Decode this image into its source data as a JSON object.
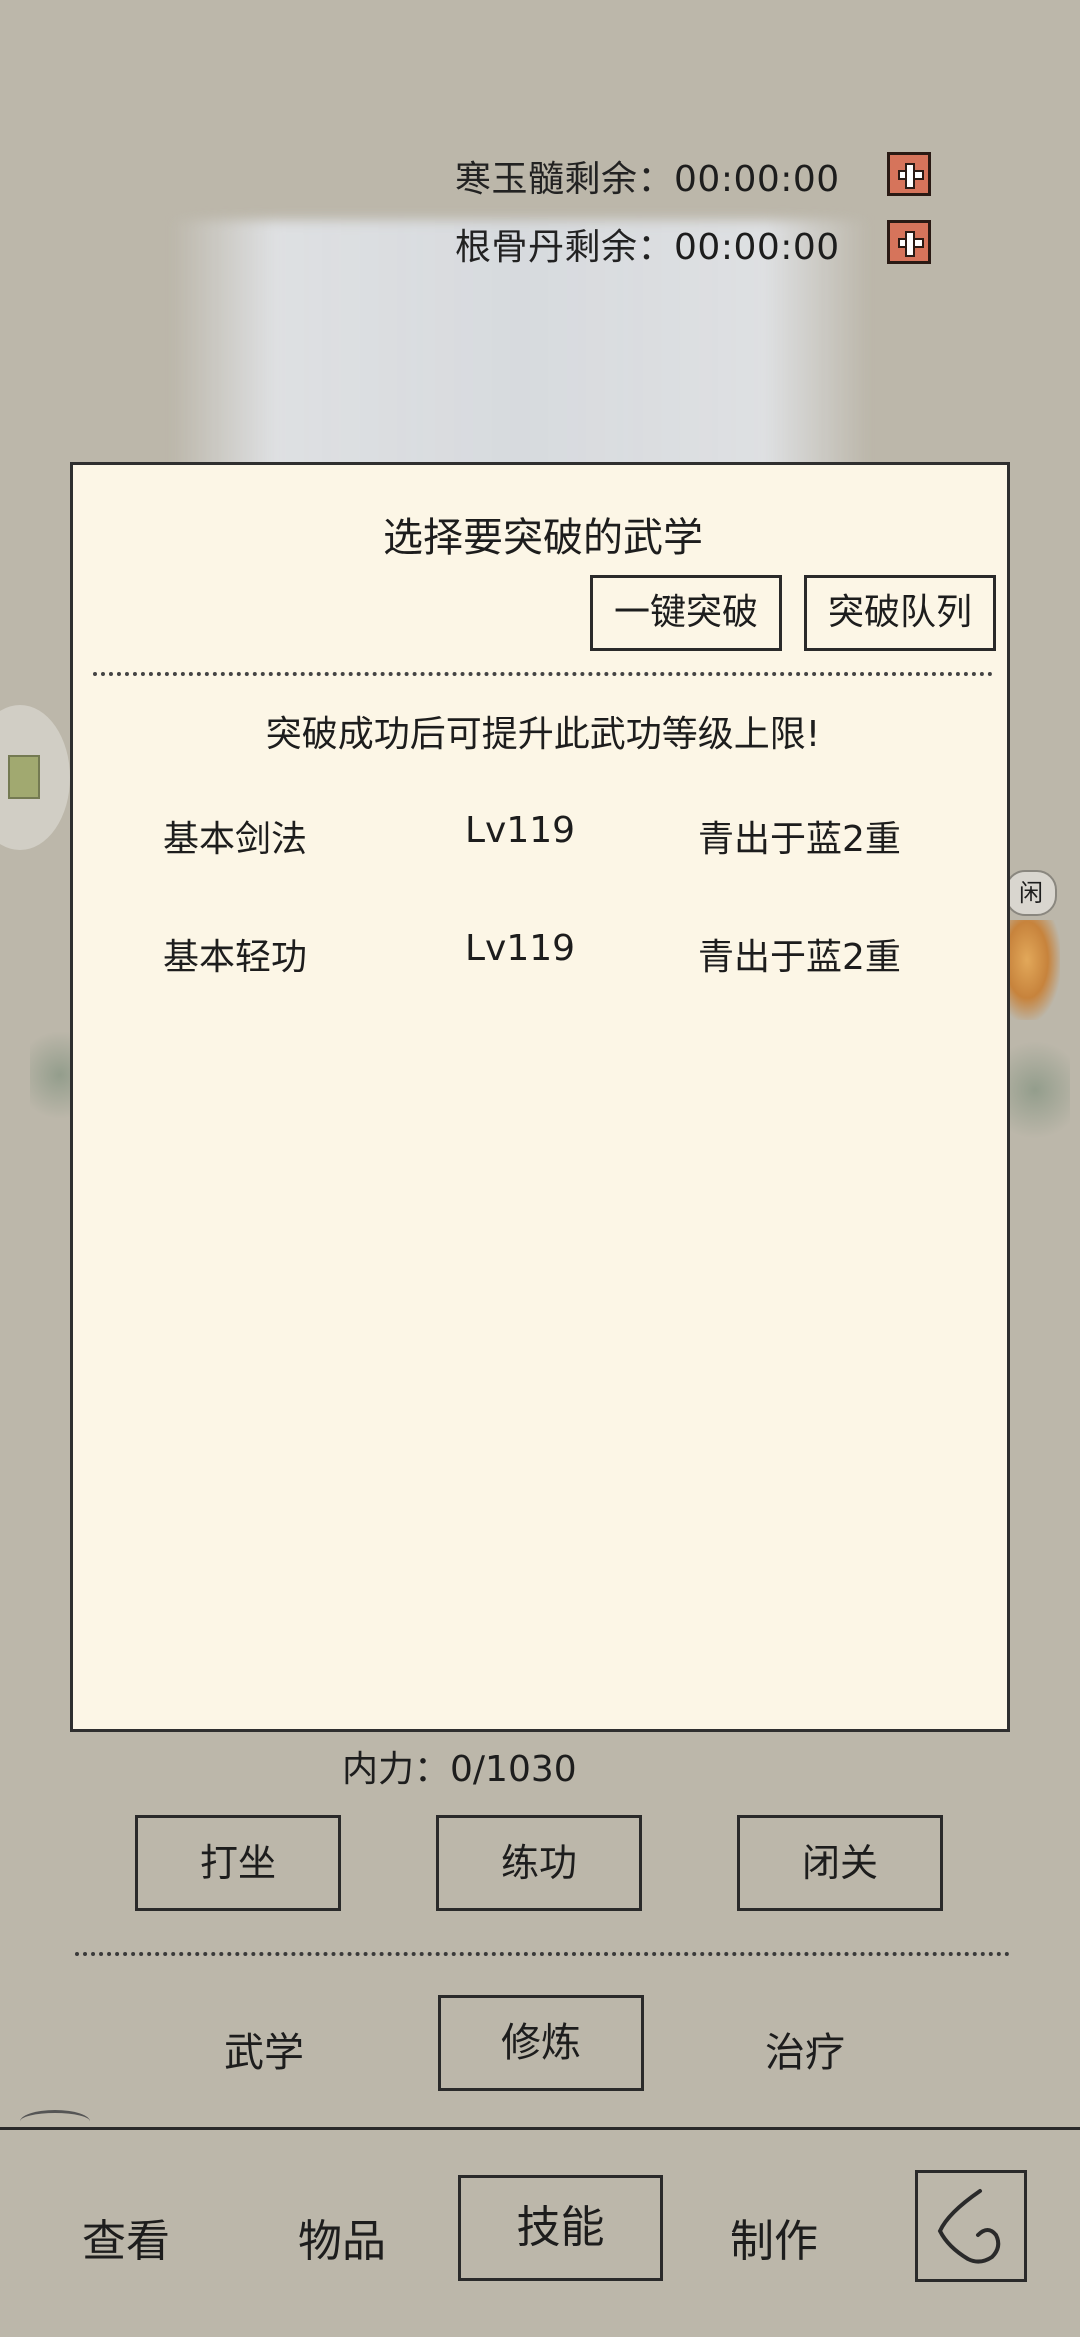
{
  "timers": [
    {
      "label": "寒玉髓剩余：",
      "value": "00:00:00"
    },
    {
      "label": "根骨丹剩余：",
      "value": "00:00:00"
    }
  ],
  "modal": {
    "title": "选择要突破的武学",
    "one_click_label": "一键突破",
    "queue_label": "突破队列",
    "hint": "突破成功后可提升此武功等级上限!",
    "skills": [
      {
        "name": "基本剑法",
        "level": "Lv119",
        "stage": "青出于蓝2重"
      },
      {
        "name": "基本轻功",
        "level": "Lv119",
        "stage": "青出于蓝2重"
      }
    ]
  },
  "neili": "内力：0/1030",
  "actions": [
    "打坐",
    "练功",
    "闭关"
  ],
  "sub_tabs": [
    "武学",
    "修炼",
    "治疗"
  ],
  "nav": [
    "查看",
    "物品",
    "技能",
    "制作"
  ],
  "side_tab_char": "闲",
  "colors": {
    "plus_button": "#d6745b",
    "modal_bg": "#fcf6e6",
    "page_bg": "#bcb7aa"
  }
}
